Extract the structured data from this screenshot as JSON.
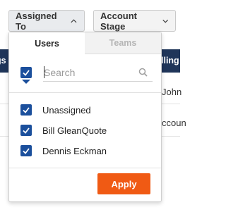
{
  "filters": {
    "assigned_to_label": "Assigned To",
    "account_stage_label": "Account Stage"
  },
  "background": {
    "header_left": "gs",
    "header_right": "lling C",
    "cells": [
      "John",
      "ccoun"
    ]
  },
  "dropdown": {
    "tabs": [
      {
        "label": "Users",
        "active": true
      },
      {
        "label": "Teams",
        "active": false
      }
    ],
    "select_all_checked": true,
    "search": {
      "value": "",
      "placeholder": "Search"
    },
    "options": [
      {
        "label": "Unassigned",
        "checked": true
      },
      {
        "label": "Bill GleanQuote",
        "checked": true
      },
      {
        "label": "Dennis Eckman",
        "checked": true
      }
    ],
    "apply_label": "Apply"
  },
  "colors": {
    "header_bg": "#1f3559",
    "checkbox": "#1b4f9c",
    "apply_button": "#f05a14"
  }
}
